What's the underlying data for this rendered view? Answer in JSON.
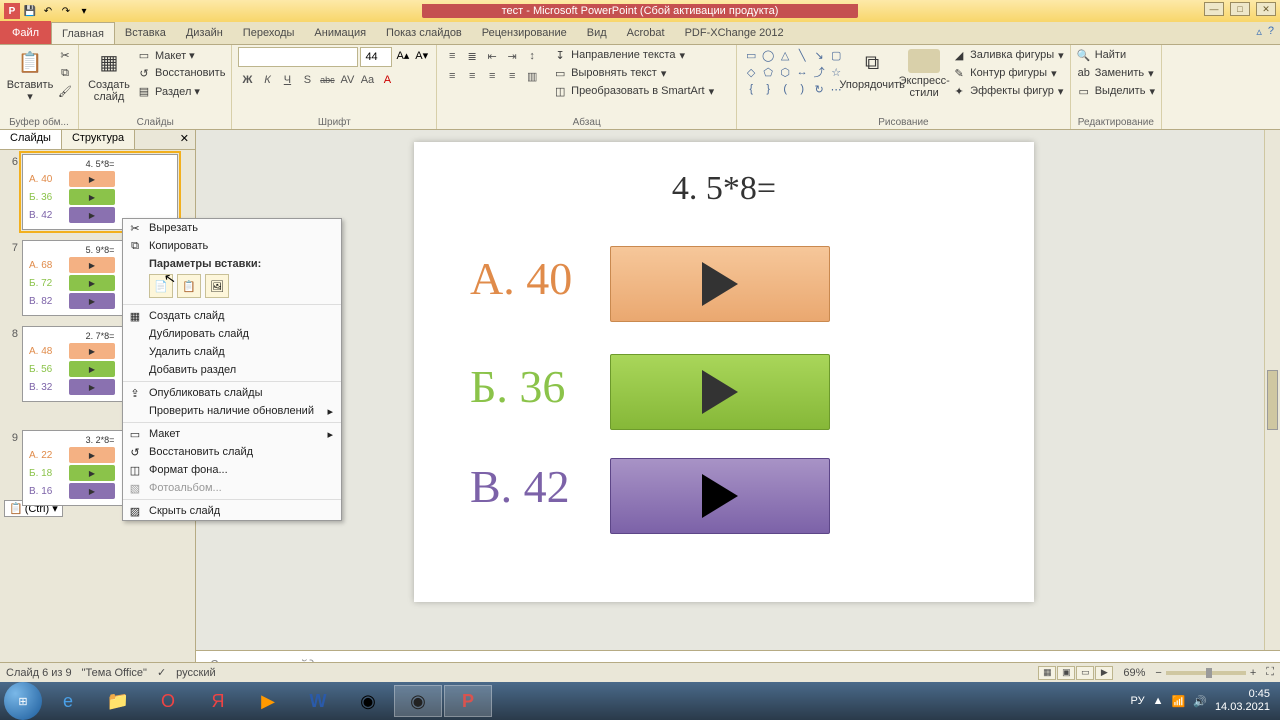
{
  "title": "тест - Microsoft PowerPoint (Сбой активации продукта)",
  "qat": {
    "save": "💾",
    "undo": "↶",
    "redo": "↷"
  },
  "tabs": {
    "file": "Файл",
    "items": [
      "Главная",
      "Вставка",
      "Дизайн",
      "Переходы",
      "Анимация",
      "Показ слайдов",
      "Рецензирование",
      "Вид",
      "Acrobat",
      "PDF-XChange 2012"
    ]
  },
  "ribbon": {
    "clipboard": {
      "paste": "Вставить",
      "cut": "✂",
      "copy": "📄",
      "label": "Буфер обм..."
    },
    "slides": {
      "new": "Создать\nслайд",
      "layout": "Макет ▾",
      "reset": "Восстановить",
      "section": "Раздел ▾",
      "label": "Слайды"
    },
    "font": {
      "size": "44",
      "label": "Шрифт",
      "buttons": [
        "Ж",
        "К",
        "Ч",
        "S",
        "abc",
        "AV",
        "Aa",
        "A"
      ]
    },
    "para": {
      "label": "Абзац",
      "textdir": "Направление текста",
      "align": "Выровнять текст",
      "smart": "Преобразовать в SmartArt"
    },
    "draw": {
      "arrange": "Упорядочить",
      "quick": "Экспресс-стили",
      "label": "Рисование",
      "fill": "Заливка фигуры",
      "outline": "Контур фигуры",
      "effects": "Эффекты фигур"
    },
    "edit": {
      "find": "Найти",
      "replace": "Заменить",
      "select": "Выделить",
      "label": "Редактирование"
    }
  },
  "sidepanel": {
    "tab1": "Слайды",
    "tab2": "Структура"
  },
  "thumbnails": [
    {
      "n": "6",
      "title": "4. 5*8=",
      "a": "А. 40",
      "b": "Б. 36",
      "c": "В. 42",
      "sel": true
    },
    {
      "n": "7",
      "title": "5. 9*8=",
      "a": "А. 68",
      "b": "Б. 72",
      "c": "В. 82"
    },
    {
      "n": "8",
      "title": "2. 7*8=",
      "a": "А. 48",
      "b": "Б. 56",
      "c": "В. 32"
    },
    {
      "n": "9",
      "title": "3. 2*8=",
      "a": "А. 22",
      "b": "Б. 18",
      "c": "В. 16"
    }
  ],
  "ctrl_pill": "(Ctrl) ▾",
  "context_menu": {
    "cut": "Вырезать",
    "copy": "Копировать",
    "paste_label": "Параметры вставки:",
    "new": "Создать слайд",
    "dup": "Дублировать слайд",
    "del": "Удалить слайд",
    "addsec": "Добавить раздел",
    "publish": "Опубликовать слайды",
    "check": "Проверить наличие обновлений",
    "layout": "Макет",
    "restore": "Восстановить слайд",
    "bgformat": "Формат фона...",
    "album": "Фотоальбом...",
    "hide": "Скрыть слайд"
  },
  "slide": {
    "question": "4. 5*8=",
    "a": "А. 40",
    "b": "Б. 36",
    "c": "В. 42"
  },
  "notes_placeholder": "Заметки к слайду",
  "status": {
    "slide": "Слайд 6 из 9",
    "theme": "\"Тема Office\"",
    "lang": "русский",
    "zoom": "69%"
  },
  "tray": {
    "lang": "РУ",
    "time": "0:45",
    "date": "14.03.2021"
  }
}
